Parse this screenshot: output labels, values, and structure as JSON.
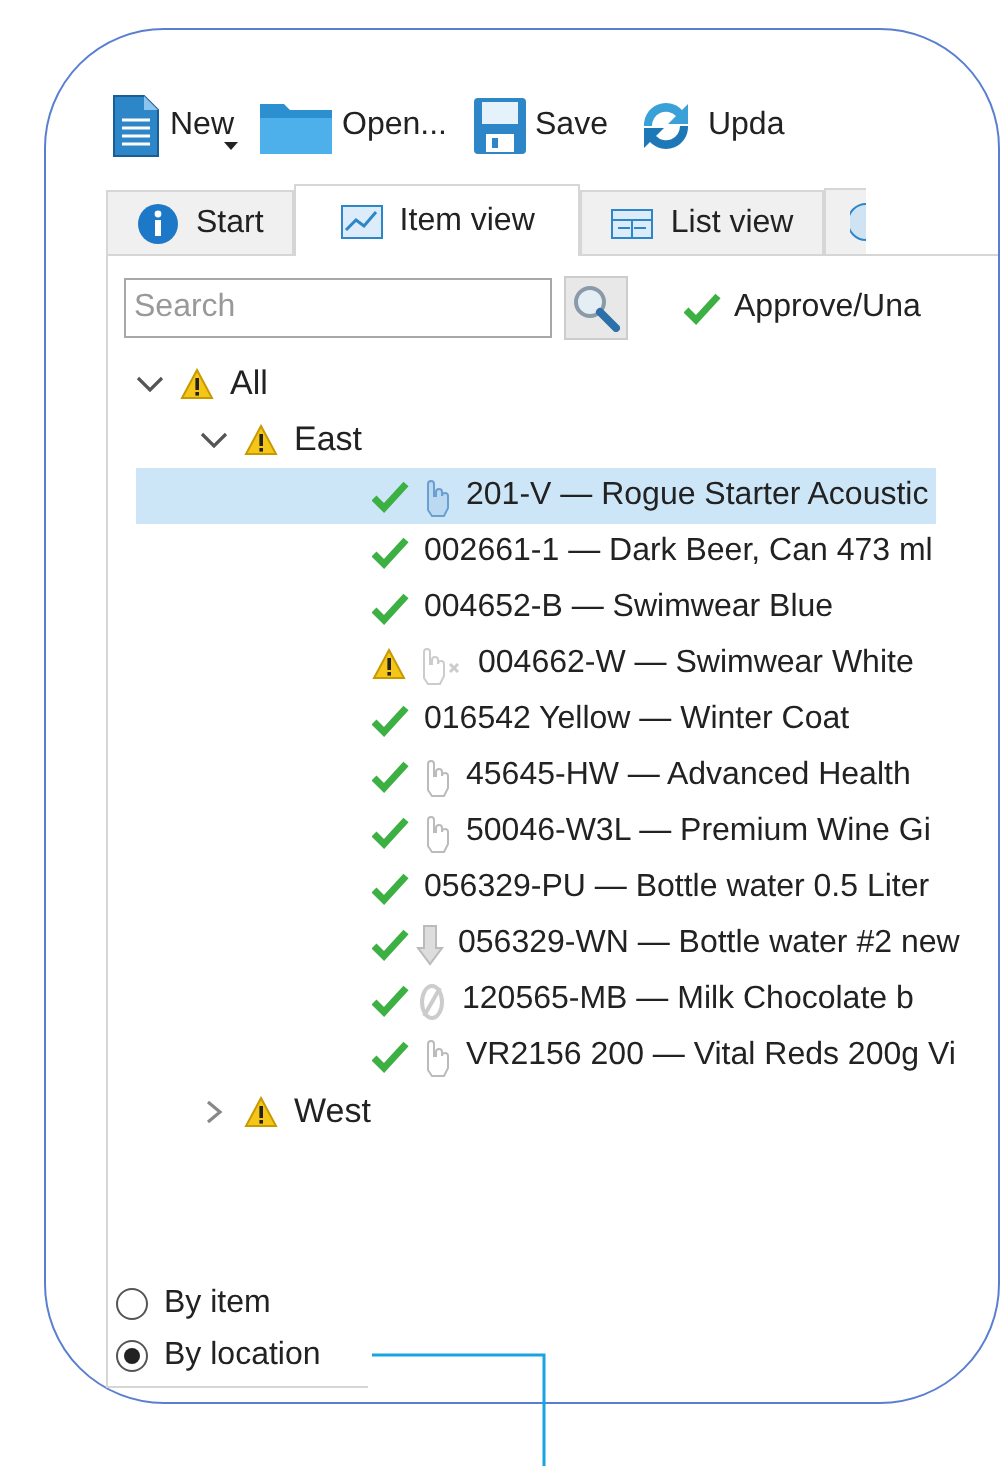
{
  "toolbar": [
    {
      "label": "New",
      "dropdown": true
    },
    {
      "label": "Open...",
      "dropdown": false
    },
    {
      "label": "Save",
      "dropdown": false
    },
    {
      "label": "Upda",
      "dropdown": false
    }
  ],
  "tabs": [
    {
      "label": "Start",
      "selected": false
    },
    {
      "label": "Item view",
      "selected": true
    },
    {
      "label": "List view",
      "selected": false
    }
  ],
  "search": {
    "placeholder": "Search"
  },
  "action": {
    "label": "Approve/Una"
  },
  "tree": [
    {
      "label": "All",
      "approved": false,
      "expanded": true,
      "children": [
        {
          "label": "East",
          "approved": false,
          "expanded": true,
          "children": [
            {
              "label": "201-V — Rogue Starter Acoustic",
              "approved": true,
              "kind": "pointer",
              "selected": true
            },
            {
              "label": "002661-1 — Dark Beer, Can 473 ml",
              "approved": true,
              "kind": "plain",
              "selected": false
            },
            {
              "label": "004652-B — Swimwear Blue",
              "approved": true,
              "kind": "plain",
              "selected": false
            },
            {
              "label": "004662-W — Swimwear White",
              "approved": false,
              "kind": "excluded",
              "selected": false
            },
            {
              "label": "016542 Yellow — Winter Coat",
              "approved": true,
              "kind": "plain",
              "selected": false
            },
            {
              "label": "45645-HW — Advanced Health",
              "approved": true,
              "kind": "pointer",
              "selected": false
            },
            {
              "label": "50046-W3L — Premium Wine Gi",
              "approved": true,
              "kind": "pointer",
              "selected": false
            },
            {
              "label": "056329-PU — Bottle water 0.5 Liter",
              "approved": true,
              "kind": "plain",
              "selected": false
            },
            {
              "label": "056329-WN — Bottle water #2 new",
              "approved": true,
              "kind": "download",
              "selected": false
            },
            {
              "label": "120565-MB — Milk Chocolate b",
              "approved": true,
              "kind": "blocked",
              "selected": false
            },
            {
              "label": "VR2156 200 — Vital Reds 200g Vi",
              "approved": true,
              "kind": "pointer",
              "selected": false
            }
          ]
        },
        {
          "label": "West",
          "approved": false,
          "expanded": false
        }
      ]
    }
  ],
  "grouping": [
    {
      "label": "By item",
      "selected": false
    },
    {
      "label": "By location",
      "selected": true
    }
  ]
}
